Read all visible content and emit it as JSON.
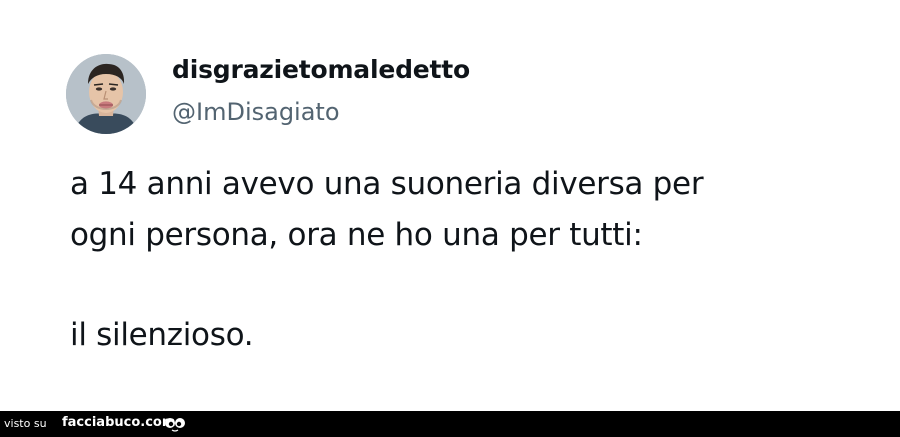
{
  "tweet": {
    "display_name": "disgrazietomaledetto",
    "handle": "@ImDisagiato",
    "text_lines": [
      "a 14 anni avevo una suoneria diversa per",
      "ogni persona, ora ne ho una per tutti:",
      "il silenzioso."
    ],
    "avatar_icon": "avatar-illustration-icon"
  },
  "footer": {
    "prefix": "visto su",
    "site": "facciabuco.com",
    "logo_icon": "googly-eyes-icon",
    "background": "#000000"
  },
  "colors": {
    "text": "#0f1419",
    "handle": "#536471",
    "background": "#ffffff"
  }
}
